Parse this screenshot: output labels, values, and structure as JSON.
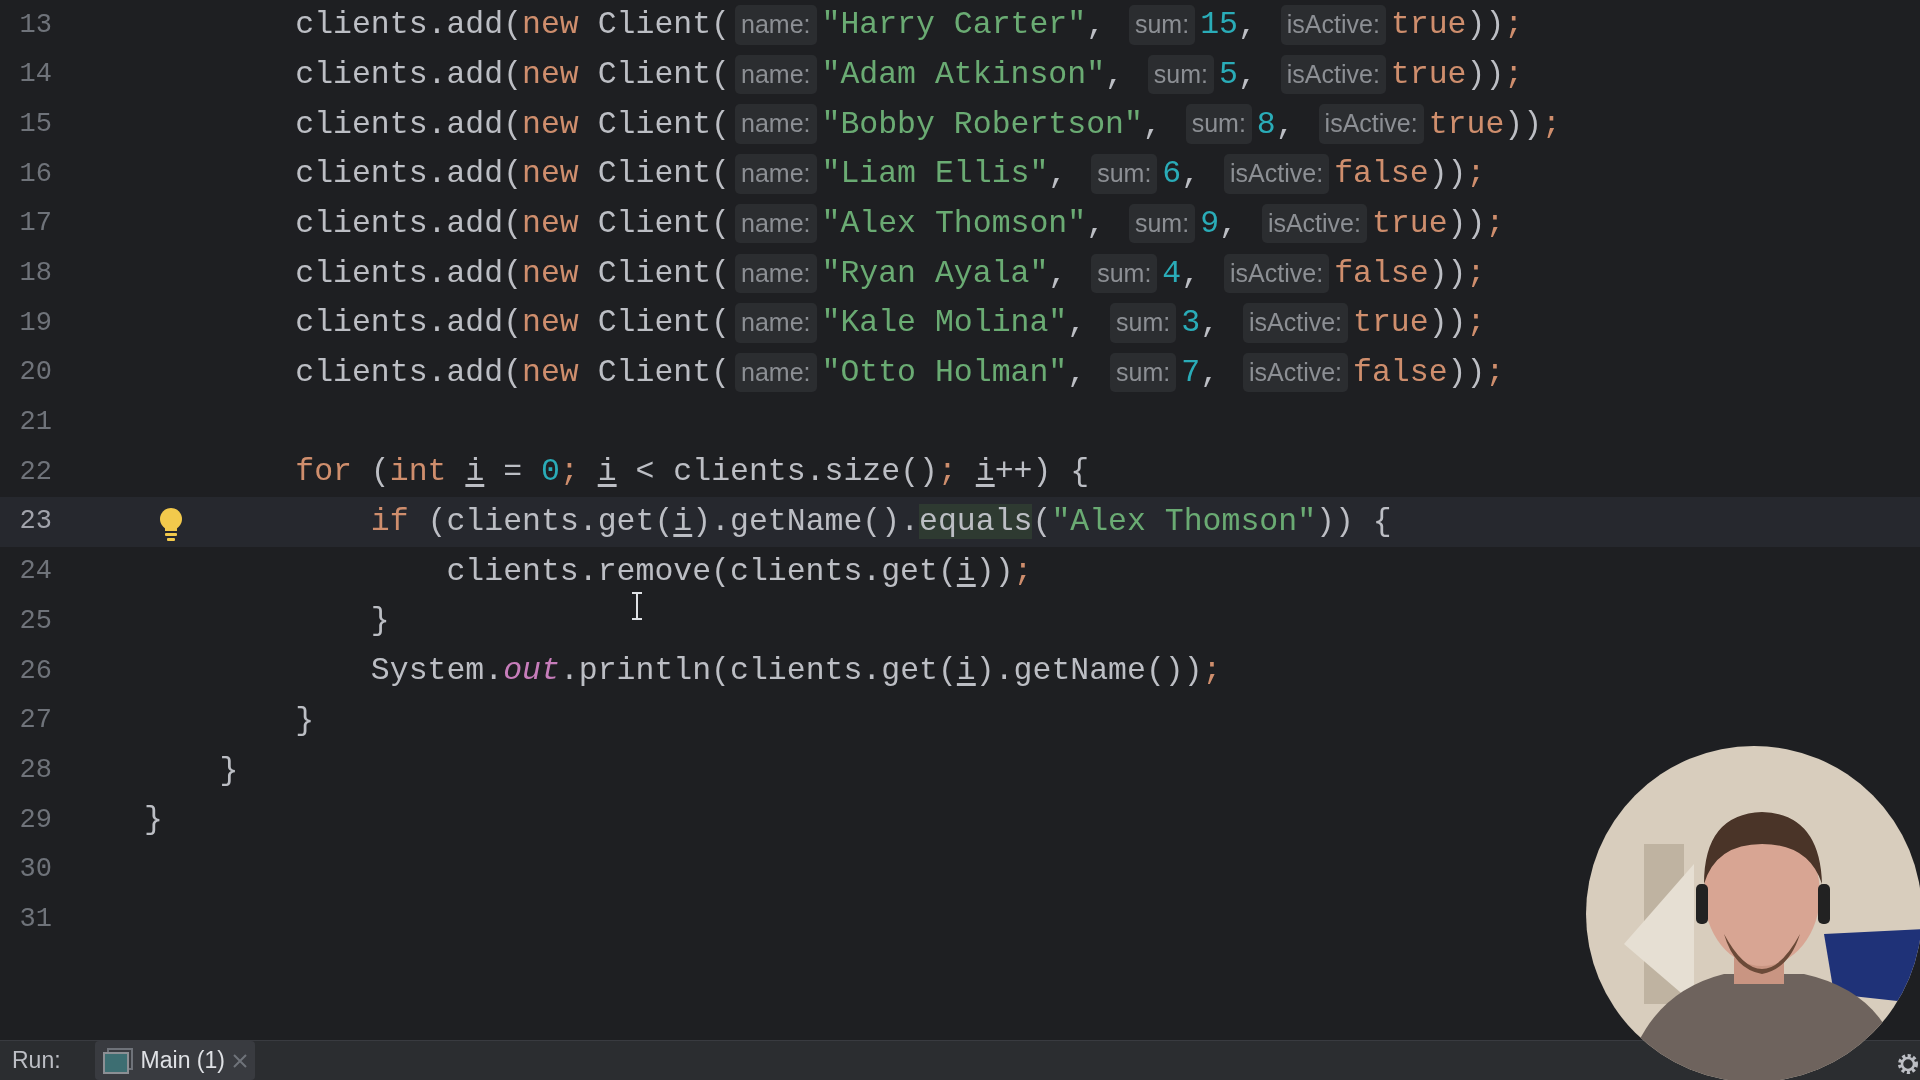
{
  "editor": {
    "lines": [
      {
        "number": "13",
        "current": false,
        "bulb": false,
        "tokens": [
          {
            "kind": "plain",
            "text": "        clients.add("
          },
          {
            "kind": "keyword",
            "text": "new"
          },
          {
            "kind": "plain",
            "text": " Client("
          },
          {
            "kind": "hint",
            "text": "name:"
          },
          {
            "kind": "string",
            "text": "\"Harry Carter\""
          },
          {
            "kind": "plain",
            "text": ", "
          },
          {
            "kind": "hint",
            "text": "sum:"
          },
          {
            "kind": "number",
            "text": "15"
          },
          {
            "kind": "plain",
            "text": ", "
          },
          {
            "kind": "hint",
            "text": "isActive:"
          },
          {
            "kind": "keyword",
            "text": "true"
          },
          {
            "kind": "plain",
            "text": "))"
          },
          {
            "kind": "keyword",
            "text": ";"
          }
        ]
      },
      {
        "number": "14",
        "current": false,
        "bulb": false,
        "tokens": [
          {
            "kind": "plain",
            "text": "        clients.add("
          },
          {
            "kind": "keyword",
            "text": "new"
          },
          {
            "kind": "plain",
            "text": " Client("
          },
          {
            "kind": "hint",
            "text": "name:"
          },
          {
            "kind": "string",
            "text": "\"Adam Atkinson\""
          },
          {
            "kind": "plain",
            "text": ", "
          },
          {
            "kind": "hint",
            "text": "sum:"
          },
          {
            "kind": "number",
            "text": "5"
          },
          {
            "kind": "plain",
            "text": ", "
          },
          {
            "kind": "hint",
            "text": "isActive:"
          },
          {
            "kind": "keyword",
            "text": "true"
          },
          {
            "kind": "plain",
            "text": "))"
          },
          {
            "kind": "keyword",
            "text": ";"
          }
        ]
      },
      {
        "number": "15",
        "current": false,
        "bulb": false,
        "tokens": [
          {
            "kind": "plain",
            "text": "        clients.add("
          },
          {
            "kind": "keyword",
            "text": "new"
          },
          {
            "kind": "plain",
            "text": " Client("
          },
          {
            "kind": "hint",
            "text": "name:"
          },
          {
            "kind": "string",
            "text": "\"Bobby Robertson\""
          },
          {
            "kind": "plain",
            "text": ", "
          },
          {
            "kind": "hint",
            "text": "sum:"
          },
          {
            "kind": "number",
            "text": "8"
          },
          {
            "kind": "plain",
            "text": ", "
          },
          {
            "kind": "hint",
            "text": "isActive:"
          },
          {
            "kind": "keyword",
            "text": "true"
          },
          {
            "kind": "plain",
            "text": "))"
          },
          {
            "kind": "keyword",
            "text": ";"
          }
        ]
      },
      {
        "number": "16",
        "current": false,
        "bulb": false,
        "tokens": [
          {
            "kind": "plain",
            "text": "        clients.add("
          },
          {
            "kind": "keyword",
            "text": "new"
          },
          {
            "kind": "plain",
            "text": " Client("
          },
          {
            "kind": "hint",
            "text": "name:"
          },
          {
            "kind": "string",
            "text": "\"Liam Ellis\""
          },
          {
            "kind": "plain",
            "text": ", "
          },
          {
            "kind": "hint",
            "text": "sum:"
          },
          {
            "kind": "number",
            "text": "6"
          },
          {
            "kind": "plain",
            "text": ", "
          },
          {
            "kind": "hint",
            "text": "isActive:"
          },
          {
            "kind": "keyword",
            "text": "false"
          },
          {
            "kind": "plain",
            "text": "))"
          },
          {
            "kind": "keyword",
            "text": ";"
          }
        ]
      },
      {
        "number": "17",
        "current": false,
        "bulb": false,
        "tokens": [
          {
            "kind": "plain",
            "text": "        clients.add("
          },
          {
            "kind": "keyword",
            "text": "new"
          },
          {
            "kind": "plain",
            "text": " Client("
          },
          {
            "kind": "hint",
            "text": "name:"
          },
          {
            "kind": "string",
            "text": "\"Alex Thomson\""
          },
          {
            "kind": "plain",
            "text": ", "
          },
          {
            "kind": "hint",
            "text": "sum:"
          },
          {
            "kind": "number",
            "text": "9"
          },
          {
            "kind": "plain",
            "text": ", "
          },
          {
            "kind": "hint",
            "text": "isActive:"
          },
          {
            "kind": "keyword",
            "text": "true"
          },
          {
            "kind": "plain",
            "text": "))"
          },
          {
            "kind": "keyword",
            "text": ";"
          }
        ]
      },
      {
        "number": "18",
        "current": false,
        "bulb": false,
        "tokens": [
          {
            "kind": "plain",
            "text": "        clients.add("
          },
          {
            "kind": "keyword",
            "text": "new"
          },
          {
            "kind": "plain",
            "text": " Client("
          },
          {
            "kind": "hint",
            "text": "name:"
          },
          {
            "kind": "string",
            "text": "\"Ryan Ayala\""
          },
          {
            "kind": "plain",
            "text": ", "
          },
          {
            "kind": "hint",
            "text": "sum:"
          },
          {
            "kind": "number",
            "text": "4"
          },
          {
            "kind": "plain",
            "text": ", "
          },
          {
            "kind": "hint",
            "text": "isActive:"
          },
          {
            "kind": "keyword",
            "text": "false"
          },
          {
            "kind": "plain",
            "text": "))"
          },
          {
            "kind": "keyword",
            "text": ";"
          }
        ]
      },
      {
        "number": "19",
        "current": false,
        "bulb": false,
        "tokens": [
          {
            "kind": "plain",
            "text": "        clients.add("
          },
          {
            "kind": "keyword",
            "text": "new"
          },
          {
            "kind": "plain",
            "text": " Client("
          },
          {
            "kind": "hint",
            "text": "name:"
          },
          {
            "kind": "string",
            "text": "\"Kale Molina\""
          },
          {
            "kind": "plain",
            "text": ", "
          },
          {
            "kind": "hint",
            "text": "sum:"
          },
          {
            "kind": "number",
            "text": "3"
          },
          {
            "kind": "plain",
            "text": ", "
          },
          {
            "kind": "hint",
            "text": "isActive:"
          },
          {
            "kind": "keyword",
            "text": "true"
          },
          {
            "kind": "plain",
            "text": "))"
          },
          {
            "kind": "keyword",
            "text": ";"
          }
        ]
      },
      {
        "number": "20",
        "current": false,
        "bulb": false,
        "tokens": [
          {
            "kind": "plain",
            "text": "        clients.add("
          },
          {
            "kind": "keyword",
            "text": "new"
          },
          {
            "kind": "plain",
            "text": " Client("
          },
          {
            "kind": "hint",
            "text": "name:"
          },
          {
            "kind": "string",
            "text": "\"Otto Holman\""
          },
          {
            "kind": "plain",
            "text": ", "
          },
          {
            "kind": "hint",
            "text": "sum:"
          },
          {
            "kind": "number",
            "text": "7"
          },
          {
            "kind": "plain",
            "text": ", "
          },
          {
            "kind": "hint",
            "text": "isActive:"
          },
          {
            "kind": "keyword",
            "text": "false"
          },
          {
            "kind": "plain",
            "text": "))"
          },
          {
            "kind": "keyword",
            "text": ";"
          }
        ]
      },
      {
        "number": "21",
        "current": false,
        "bulb": false
      },
      {
        "number": "22",
        "current": false,
        "bulb": false,
        "tokens": [
          {
            "kind": "keyword",
            "text": "        for"
          },
          {
            "kind": "plain",
            "text": " ("
          },
          {
            "kind": "keyword",
            "text": "int "
          },
          {
            "kind": "variable",
            "text": "i"
          },
          {
            "kind": "plain",
            "text": " = "
          },
          {
            "kind": "number",
            "text": "0"
          },
          {
            "kind": "keyword",
            "text": "; "
          },
          {
            "kind": "variable",
            "text": "i"
          },
          {
            "kind": "plain",
            "text": " < clients.size()"
          },
          {
            "kind": "keyword",
            "text": "; "
          },
          {
            "kind": "variable",
            "text": "i"
          },
          {
            "kind": "plain",
            "text": "++) {"
          }
        ]
      },
      {
        "number": "23",
        "current": true,
        "bulb": true,
        "tokens": [
          {
            "kind": "keyword",
            "text": "            if"
          },
          {
            "kind": "plain",
            "text": " (clients.get("
          },
          {
            "kind": "variable",
            "text": "i"
          },
          {
            "kind": "plain",
            "text": ").getName()."
          },
          {
            "kind": "match",
            "text": "equals"
          },
          {
            "kind": "plain",
            "text": "("
          },
          {
            "kind": "string",
            "text": "\"Alex Thomson\""
          },
          {
            "kind": "plain",
            "text": ")) {"
          }
        ]
      },
      {
        "number": "24",
        "current": false,
        "bulb": false,
        "tokens": [
          {
            "kind": "plain",
            "text": "                clients.remove(clients.get("
          },
          {
            "kind": "variable",
            "text": "i"
          },
          {
            "kind": "plain",
            "text": "))"
          },
          {
            "kind": "keyword",
            "text": ";"
          }
        ]
      },
      {
        "number": "25",
        "current": false,
        "bulb": false,
        "tokens": [
          {
            "kind": "plain",
            "text": "            }"
          }
        ]
      },
      {
        "number": "26",
        "current": false,
        "bulb": false,
        "tokens": [
          {
            "kind": "plain",
            "text": "            System."
          },
          {
            "kind": "static",
            "text": "out"
          },
          {
            "kind": "plain",
            "text": ".println(clients.get("
          },
          {
            "kind": "variable",
            "text": "i"
          },
          {
            "kind": "plain",
            "text": ").getName())"
          },
          {
            "kind": "keyword",
            "text": ";"
          }
        ]
      },
      {
        "number": "27",
        "current": false,
        "bulb": false,
        "tokens": [
          {
            "kind": "plain",
            "text": "        }"
          }
        ]
      },
      {
        "number": "28",
        "current": false,
        "bulb": false,
        "tokens": [
          {
            "kind": "plain",
            "text": "    }"
          }
        ]
      },
      {
        "number": "29",
        "current": false,
        "bulb": false,
        "tokens": [
          {
            "kind": "plain",
            "text": "}"
          }
        ]
      },
      {
        "number": "30",
        "current": false,
        "bulb": false
      },
      {
        "number": "31",
        "current": false,
        "bulb": false
      }
    ]
  },
  "run_bar": {
    "label": "Run:",
    "tabs": [
      {
        "label": "Main (1)",
        "selected": true
      }
    ]
  }
}
